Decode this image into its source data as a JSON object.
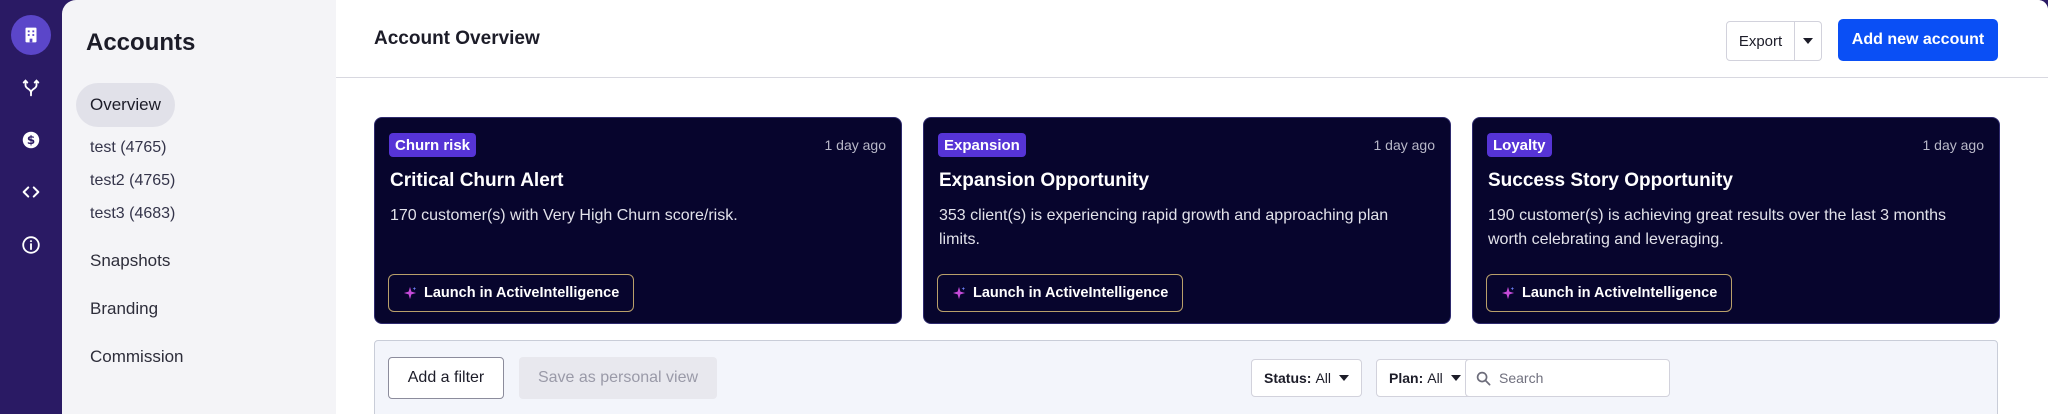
{
  "rail": {
    "icons": [
      "building-icon",
      "branch-icon",
      "dollar-icon",
      "code-icon",
      "info-icon"
    ]
  },
  "sidebar": {
    "title": "Accounts",
    "overview_label": "Overview",
    "views": [
      "test (4765)",
      "test2 (4765)",
      "test3 (4683)"
    ],
    "items": [
      "Snapshots",
      "Branding",
      "Commission"
    ]
  },
  "header": {
    "title": "Account Overview",
    "export_label": "Export",
    "add_label": "Add new account"
  },
  "cards": [
    {
      "badge": "Churn risk",
      "time": "1 day ago",
      "title": "Critical Churn Alert",
      "description": "170 customer(s) with Very High Churn score/risk.",
      "button": "Launch in ActiveIntelligence"
    },
    {
      "badge": "Expansion",
      "time": "1 day ago",
      "title": "Expansion Opportunity",
      "description": "353 client(s) is experiencing rapid growth and approaching plan limits.",
      "button": "Launch in ActiveIntelligence"
    },
    {
      "badge": "Loyalty",
      "time": "1 day ago",
      "title": "Success Story Opportunity",
      "description": "190 customer(s) is achieving great results over the last 3 months worth celebrating and leveraging.",
      "button": "Launch in ActiveIntelligence"
    }
  ],
  "filters": {
    "add_filter": "Add a filter",
    "save_view": "Save as personal view",
    "status_label": "Status:",
    "status_value": "All",
    "plan_label": "Plan:",
    "plan_value": "All",
    "search_placeholder": "Search"
  },
  "colors": {
    "accent": "#0a4ff5",
    "rail": "#2a1a64",
    "card_bg": "#07052d",
    "badge": "#5634d6"
  }
}
